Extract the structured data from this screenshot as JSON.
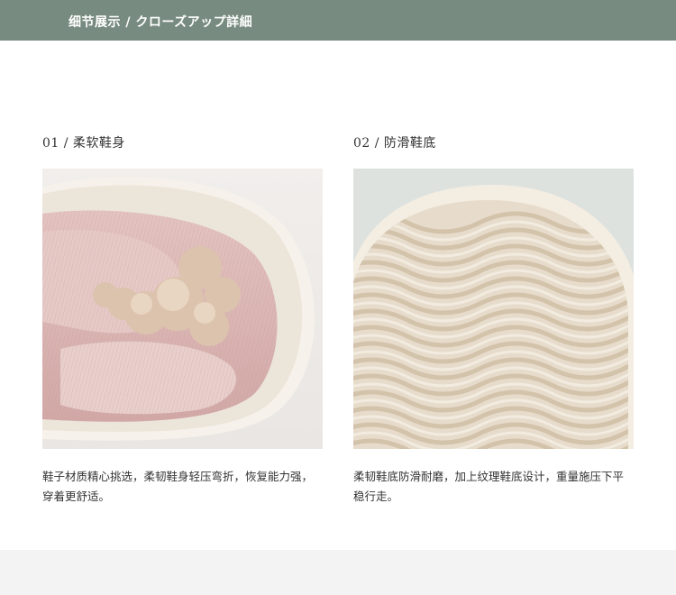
{
  "header": {
    "title": "细节展示 / クローズアップ詳細",
    "bg_color": "#788b80"
  },
  "cards": [
    {
      "heading": "01 / 柔软鞋身",
      "image_subject": "folded pink slipper with fleece lining",
      "text": "鞋子材质精心挑选，柔韧鞋身轻压弯折，恢复能力强，穿着更舒适。"
    },
    {
      "heading": "02 / 防滑鞋底",
      "image_subject": "cream sole with wavy anti-slip texture",
      "text": "柔韧鞋底防滑耐磨，加上纹理鞋底设计，重量施压下平稳行走。"
    }
  ]
}
